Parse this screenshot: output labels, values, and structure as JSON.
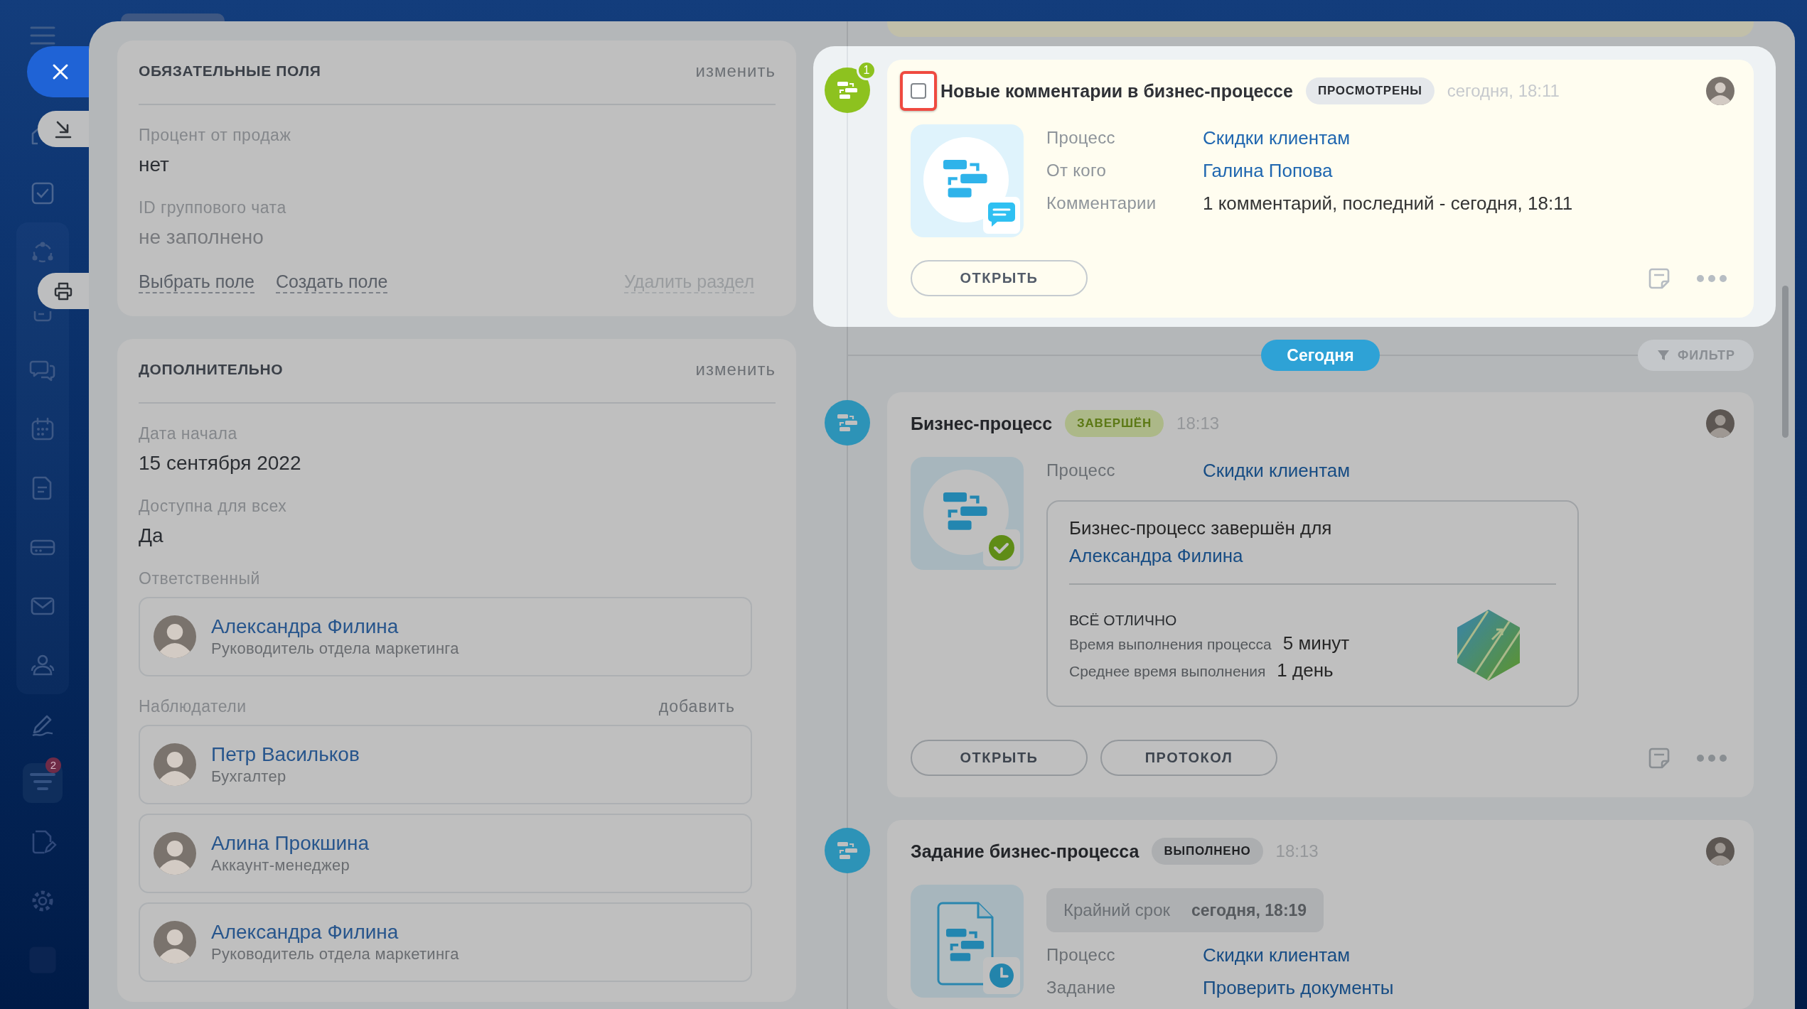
{
  "sidebar": {
    "counter": "2"
  },
  "left_panel": {
    "sections": [
      {
        "title": "ОБЯЗАТЕЛЬНЫЕ ПОЛЯ",
        "action": "изменить",
        "fields": [
          {
            "label": "Процент от продаж",
            "value": "нет",
            "empty": false
          },
          {
            "label": "ID группового чата",
            "value": "не заполнено",
            "empty": true
          }
        ],
        "links": [
          "Выбрать поле",
          "Создать поле"
        ],
        "remove_link": "Удалить раздел"
      },
      {
        "title": "ДОПОЛНИТЕЛЬНО",
        "action": "изменить",
        "fields": [
          {
            "label": "Дата начала",
            "value": "15 сентября 2022",
            "empty": false
          },
          {
            "label": "Доступна для всех",
            "value": "Да",
            "empty": false
          }
        ],
        "responsible": {
          "label": "Ответственный",
          "people": [
            {
              "name": "Александра Филина",
              "role": "Руководитель отдела маркетинга"
            }
          ]
        },
        "observers": {
          "label": "Наблюдатели",
          "action": "добавить",
          "people": [
            {
              "name": "Петр Васильков",
              "role": "Бухгалтер"
            },
            {
              "name": "Алина Прокшина",
              "role": "Аккаунт-менеджер"
            },
            {
              "name": "Александра Филина",
              "role": "Руководитель отдела маркетинга"
            }
          ]
        }
      }
    ]
  },
  "timeline": {
    "top_entries": [
      {
        "kind": "comments",
        "highlighted": true,
        "counter": "1",
        "checkbox": {
          "checked": false,
          "outlined": true
        },
        "title": "Новые комментарии в бизнес-процессе",
        "status": {
          "text": "ПРОСМОТРЕНЫ",
          "kind": "neutral"
        },
        "time": "сегодня, 18:11",
        "fields": [
          {
            "label": "Процесс",
            "value": "Скидки клиентам",
            "link": true
          },
          {
            "label": "От кого",
            "value": "Галина Попова",
            "link": true
          },
          {
            "label": "Комментарии",
            "value": "1 комментарий, последний - сегодня, 18:11",
            "link": false
          }
        ],
        "buttons": [
          "ОТКРЫТЬ"
        ]
      }
    ],
    "day": {
      "label": "Сегодня",
      "filter": "ФИЛЬТР",
      "entries": [
        {
          "kind": "process",
          "highlighted": false,
          "title": "Бизнес-процесс",
          "status": {
            "text": "ЗАВЕРШЁН",
            "kind": "success"
          },
          "time": "18:13",
          "fields": [
            {
              "label": "Процесс",
              "value": "Скидки клиентам",
              "link": true
            }
          ],
          "result": {
            "text": "Бизнес-процесс завершён для ",
            "person": "Александра Филина",
            "verdict": "ВСЁ ОТЛИЧНО",
            "stats": [
              {
                "label": "Время выполнения процесса",
                "value": "5 минут"
              },
              {
                "label": "Среднее время выполнения",
                "value": "1 день"
              }
            ]
          },
          "buttons": [
            "ОТКРЫТЬ",
            "ПРОТОКОЛ"
          ]
        },
        {
          "kind": "task",
          "highlighted": false,
          "title": "Задание бизнес-процесса",
          "status": {
            "text": "ВЫПОЛНЕНО",
            "kind": "neutral"
          },
          "time": "18:13",
          "deadline": {
            "label": "Крайний срок",
            "value": "сегодня, 18:19"
          },
          "fields": [
            {
              "label": "Процесс",
              "value": "Скидки клиентам",
              "link": true
            },
            {
              "label": "Задание",
              "value": "Проверить документы",
              "link": true
            }
          ]
        }
      ]
    }
  }
}
